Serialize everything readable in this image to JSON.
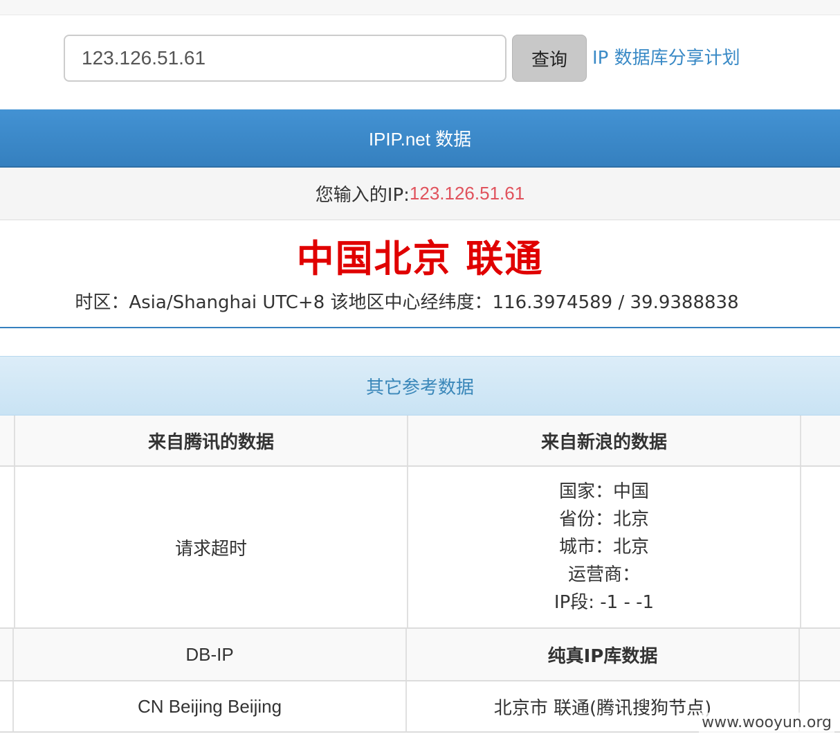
{
  "search": {
    "value": "123.126.51.61",
    "button_label": "查询",
    "share_link": "IP 数据库分享计划"
  },
  "ipip": {
    "header": "IPIP.net 数据",
    "input_label": "您输入的IP: ",
    "input_ip": "123.126.51.61",
    "location": "中国北京 联通",
    "timezone_line": "时区：Asia/Shanghai UTC+8 该地区中心经纬度：116.3974589 / 39.9388838"
  },
  "reference": {
    "header": "其它参考数据",
    "tencent_header": "来自腾讯的数据",
    "tencent_value": "请求超时",
    "sina_header": "来自新浪的数据",
    "sina_lines": [
      "国家：中国",
      "省份：北京",
      "城市：北京",
      "运营商：",
      "IP段: -1 - -1"
    ],
    "dbip_header": "DB-IP",
    "dbip_value": "CN Beijing Beijing",
    "chunzhen_header": "纯真IP库数据",
    "chunzhen_value": "北京市 联通(腾讯搜狗节点)"
  },
  "watermark": "www.wooyun.org",
  "colors": {
    "primary": "#3580bf",
    "info_text": "#3a87b9",
    "ip_red": "#e0525c",
    "location_red": "#e00000"
  }
}
